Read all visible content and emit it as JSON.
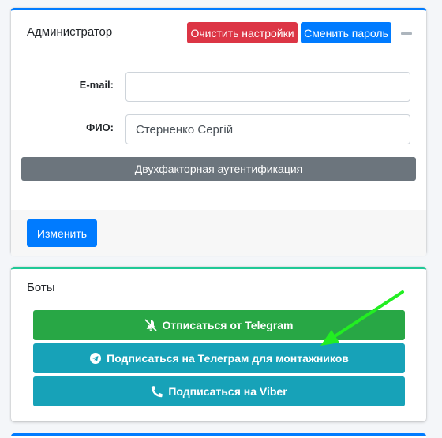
{
  "admin": {
    "title": "Администратор",
    "clear_settings_label": "Очистить настройки",
    "change_password_label": "Сменить пароль",
    "email_label": "E-mail:",
    "email_value": "",
    "fio_label": "ФИО:",
    "fio_value": "Стерненко Сергій",
    "twofa_label": "Двухфакторная аутентификация",
    "change_label": "Изменить"
  },
  "bots": {
    "title": "Боты",
    "unsubscribe_telegram_label": "Отписаться от Telegram",
    "subscribe_telegram_installers_label": "Подписаться на Телеграм для монтажников",
    "subscribe_viber_label": "Подписаться на Viber"
  },
  "icons": {
    "unsubscribe_telegram": "bell-slash-icon",
    "subscribe_telegram": "telegram-icon",
    "subscribe_viber": "phone-icon",
    "collapse": "minus-icon",
    "annotation": "green-arrow"
  },
  "colors": {
    "primary": "#007bff",
    "danger": "#dc3545",
    "secondary": "#6c757d",
    "success": "#28a745",
    "info": "#17a2b8",
    "teal_accent": "#20c997",
    "arrow": "#22ee22"
  }
}
